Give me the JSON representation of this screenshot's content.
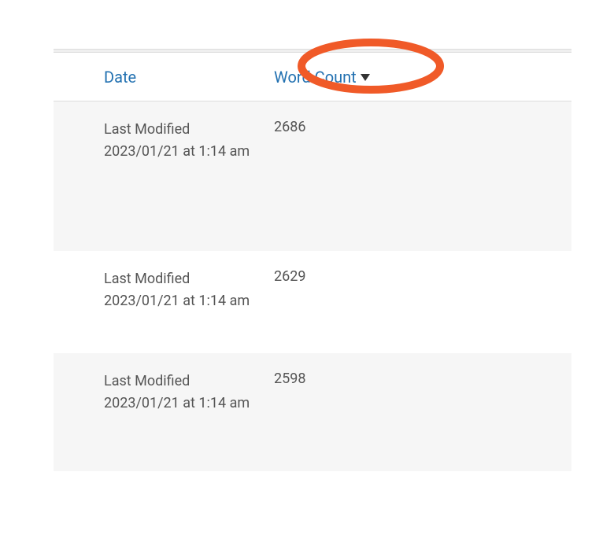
{
  "columns": {
    "date_label": "Date",
    "wordcount_label": "Word Count"
  },
  "rows": [
    {
      "modified_label": "Last Modified",
      "modified_value": "2023/01/21 at 1:14 am",
      "word_count": "2686"
    },
    {
      "modified_label": "Last Modified",
      "modified_value": "2023/01/21 at 1:14 am",
      "word_count": "2629"
    },
    {
      "modified_label": "Last Modified",
      "modified_value": "2023/01/21 at 1:14 am",
      "word_count": "2598"
    }
  ],
  "highlight_color": "#f05a28"
}
